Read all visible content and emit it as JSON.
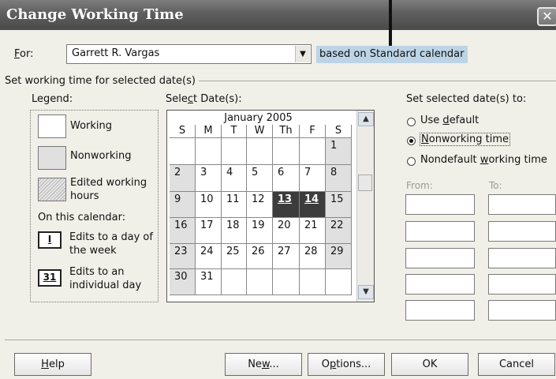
{
  "window": {
    "title": "Change Working Time",
    "close_glyph": "✕"
  },
  "for_field": {
    "label_key": "F",
    "label_rest": "or:",
    "value": "Garrett R. Vargas"
  },
  "based_on": "based on Standard calendar",
  "group_title": "Set working time for selected date(s)",
  "legend": {
    "title": "Legend:",
    "items": [
      {
        "label": "Working",
        "swatch": "working"
      },
      {
        "label": "Nonworking",
        "swatch": "nonworking"
      },
      {
        "label": "Edited working\nhours",
        "swatch": "edited-hatched"
      }
    ],
    "on_calendar": "On this calendar:",
    "edits_day_icon": "I",
    "edits_day_label": "Edits to a day of\nthe week",
    "edits_individual_icon": "31",
    "edits_individual_label": "Edits to an\nindividual day"
  },
  "select_dates": {
    "label_pre": "Sele",
    "label_key": "c",
    "label_post": "t Date(s):"
  },
  "calendar": {
    "month": "January 2005",
    "headers": [
      "S",
      "M",
      "T",
      "W",
      "Th",
      "F",
      "S"
    ],
    "rows": [
      [
        "",
        "",
        "",
        "",
        "",
        "",
        "1"
      ],
      [
        "2",
        "3",
        "4",
        "5",
        "6",
        "7",
        "8"
      ],
      [
        "9",
        "10",
        "11",
        "12",
        "13",
        "14",
        "15"
      ],
      [
        "16",
        "17",
        "18",
        "19",
        "20",
        "21",
        "22"
      ],
      [
        "23",
        "24",
        "25",
        "26",
        "27",
        "28",
        "29"
      ],
      [
        "30",
        "31",
        "",
        "",
        "",
        "",
        ""
      ]
    ],
    "selected_days": [
      "13",
      "14"
    ]
  },
  "set_selected": {
    "title": "Set selected date(s) to:",
    "options": [
      {
        "pre": "Use ",
        "key": "d",
        "post": "efault",
        "selected": false
      },
      {
        "pre": "",
        "key": "N",
        "post": "onworking time",
        "selected": true
      },
      {
        "pre": "Nondefault ",
        "key": "w",
        "post": "orking time",
        "selected": false
      }
    ]
  },
  "from_label": "From:",
  "to_label": "To:",
  "buttons": {
    "help": {
      "key": "H",
      "rest": "elp"
    },
    "new": {
      "pre": "Ne",
      "key": "w",
      "post": "..."
    },
    "options": {
      "pre": "O",
      "key": "p",
      "post": "tions..."
    },
    "ok": "OK",
    "cancel": "Cancel"
  },
  "colors": {
    "title_bar": "#5e5e5e",
    "based_on_highlight": "#bcd4e6",
    "selected_day": "#3c3c3c",
    "dialog_bg": "#f0efe8"
  }
}
